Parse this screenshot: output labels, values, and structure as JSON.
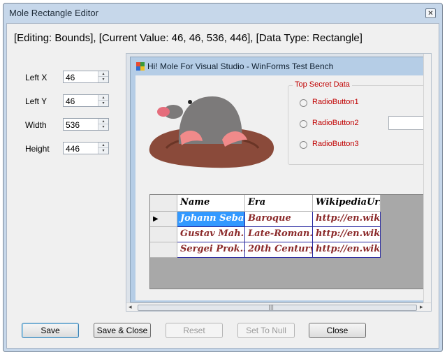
{
  "window": {
    "title": "Mole Rectangle Editor",
    "close_glyph": "✕",
    "status": "[Editing: Bounds],  [Current Value: 46, 46, 536, 446],  [Data Type: Rectangle]"
  },
  "fields": [
    {
      "label": "Left X",
      "value": "46"
    },
    {
      "label": "Left Y",
      "value": "46"
    },
    {
      "label": "Width",
      "value": "536"
    },
    {
      "label": "Height",
      "value": "446"
    }
  ],
  "preview": {
    "title": "Hi!  Mole For Visual Studio - WinForms Test Bench",
    "group_title": "Top Secret Data",
    "radios": [
      "RadioButton1",
      "RadioButton2",
      "RadioButton3"
    ],
    "grid": {
      "columns": [
        "Name",
        "Era",
        "WikipediaUri"
      ],
      "rows": [
        [
          "Johann Seba...",
          "Baroque",
          "http://en.wik..."
        ],
        [
          "Gustav Mah...",
          "Late-Roman...",
          "http://en.wik..."
        ],
        [
          "Sergei Prok...",
          "20th Century",
          "http://en.wik..."
        ]
      ],
      "row_indicator": "▶",
      "scroll_grip": "|||",
      "arrow_left": "◂",
      "arrow_right": "▸",
      "arrow_up": "▴",
      "arrow_down": "▾"
    }
  },
  "buttons": {
    "save": "Save",
    "save_close": "Save & Close",
    "reset": "Reset",
    "set_null": "Set To Null",
    "close": "Close"
  },
  "colors": {
    "accent_red": "#c00000",
    "selection": "#3399ff"
  }
}
